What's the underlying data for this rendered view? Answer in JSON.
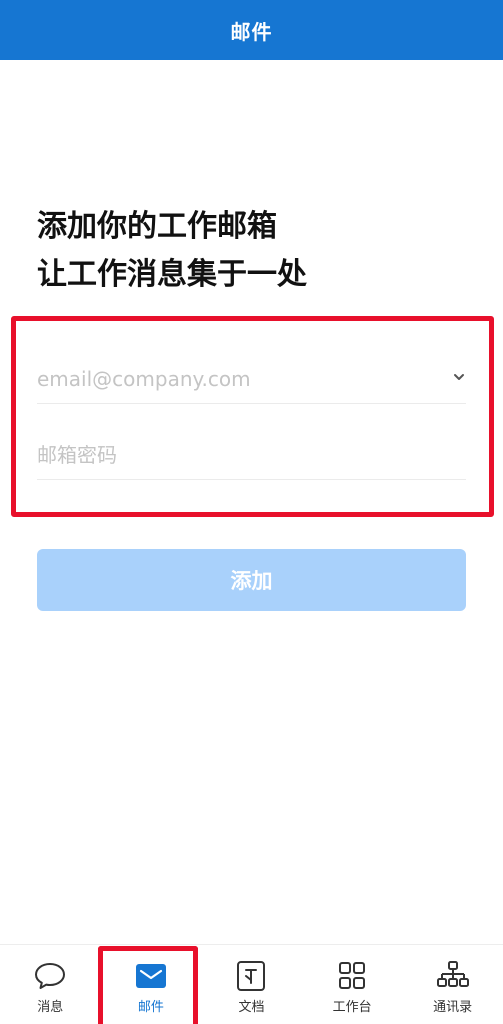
{
  "header": {
    "title": "邮件"
  },
  "main": {
    "headline_line1": "添加你的工作邮箱",
    "headline_line2": "让工作消息集于一处",
    "email_placeholder": "email@company.com",
    "password_placeholder": "邮箱密码",
    "add_button_label": "添加"
  },
  "tab_bar": {
    "active_tab": "邮件",
    "tabs": [
      {
        "label": "消息",
        "icon": "chat-bubble-icon"
      },
      {
        "label": "邮件",
        "icon": "mail-icon"
      },
      {
        "label": "文档",
        "icon": "document-icon"
      },
      {
        "label": "工作台",
        "icon": "grid-icon"
      },
      {
        "label": "通讯录",
        "icon": "org-chart-icon"
      }
    ]
  },
  "colors": {
    "brand": "#1676d2",
    "button_disabled": "#a9d1fb",
    "highlight": "#e8102b"
  }
}
